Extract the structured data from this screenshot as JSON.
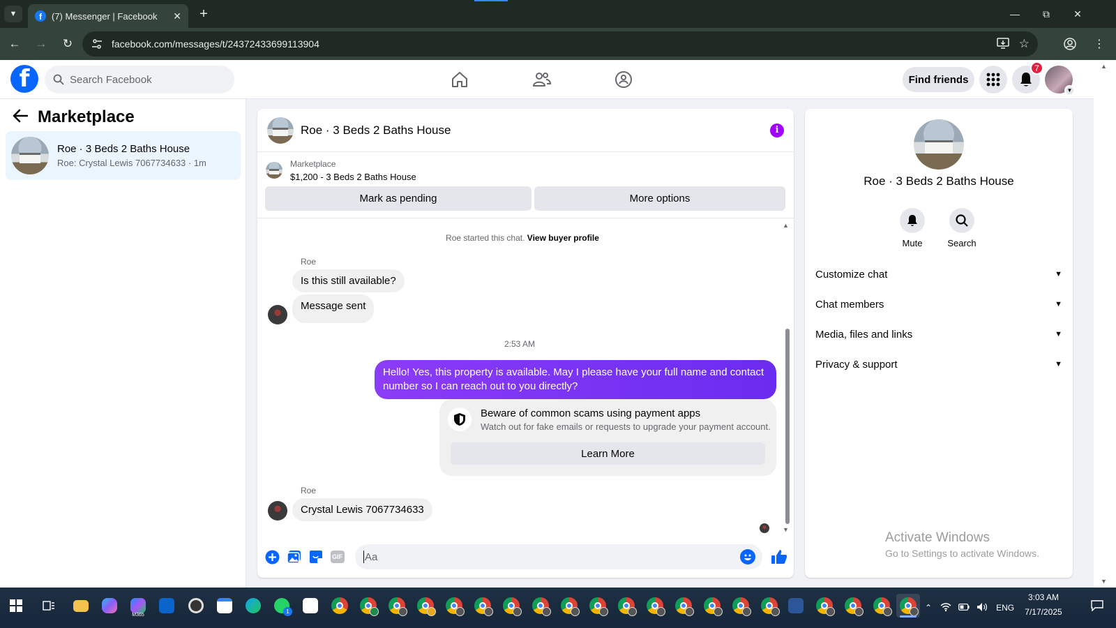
{
  "browser": {
    "tab_title": "(7) Messenger | Facebook",
    "url": "facebook.com/messages/t/24372433699113904"
  },
  "fb": {
    "search_placeholder": "Search Facebook",
    "find_friends": "Find friends",
    "notification_count": "7"
  },
  "left": {
    "title": "Marketplace",
    "thread": {
      "name": "Roe · 3 Beds 2 Baths House",
      "preview": "Roe: Crystal Lewis 7067734633 · 1m"
    }
  },
  "chat": {
    "title": "Roe · 3 Beds 2 Baths House",
    "marketplace_label": "Marketplace",
    "listing": "$1,200 - 3 Beds 2 Baths House",
    "mark_pending": "Mark as pending",
    "more_options": "More options",
    "started_text": "Roe started this chat.",
    "view_profile": "View buyer profile",
    "sender1": "Roe",
    "msg1": "Is this still available?",
    "msg2": "Message sent",
    "timestamp": "2:53 AM",
    "sent_msg": "Hello! Yes, this property is available. May I please have your full name and contact number so I can reach out to you directly?",
    "scam_title": "Beware of common scams using payment apps",
    "scam_desc": "Watch out for fake emails or requests to upgrade your payment account.",
    "learn_more": "Learn More",
    "sender2": "Roe",
    "msg3": "Crystal Lewis 7067734633",
    "composer_placeholder": "Aa",
    "gif_label": "GIF"
  },
  "right": {
    "name": "Roe · 3 Beds 2 Baths House",
    "mute": "Mute",
    "search": "Search",
    "rows": [
      "Customize chat",
      "Chat members",
      "Media, files and links",
      "Privacy & support"
    ]
  },
  "watermark": {
    "line1": "Activate Windows",
    "line2": "Go to Settings to activate Windows."
  },
  "taskbar": {
    "lang": "ENG",
    "time": "3:03 AM",
    "date": "7/17/2025",
    "whatsapp_badge": "1",
    "m365_label": "M365"
  },
  "colors": {
    "fb_blue": "#0866ff",
    "sent_bubble": "#7b35f0",
    "info_purple": "#a100ff",
    "badge_red": "#e41e3f"
  }
}
